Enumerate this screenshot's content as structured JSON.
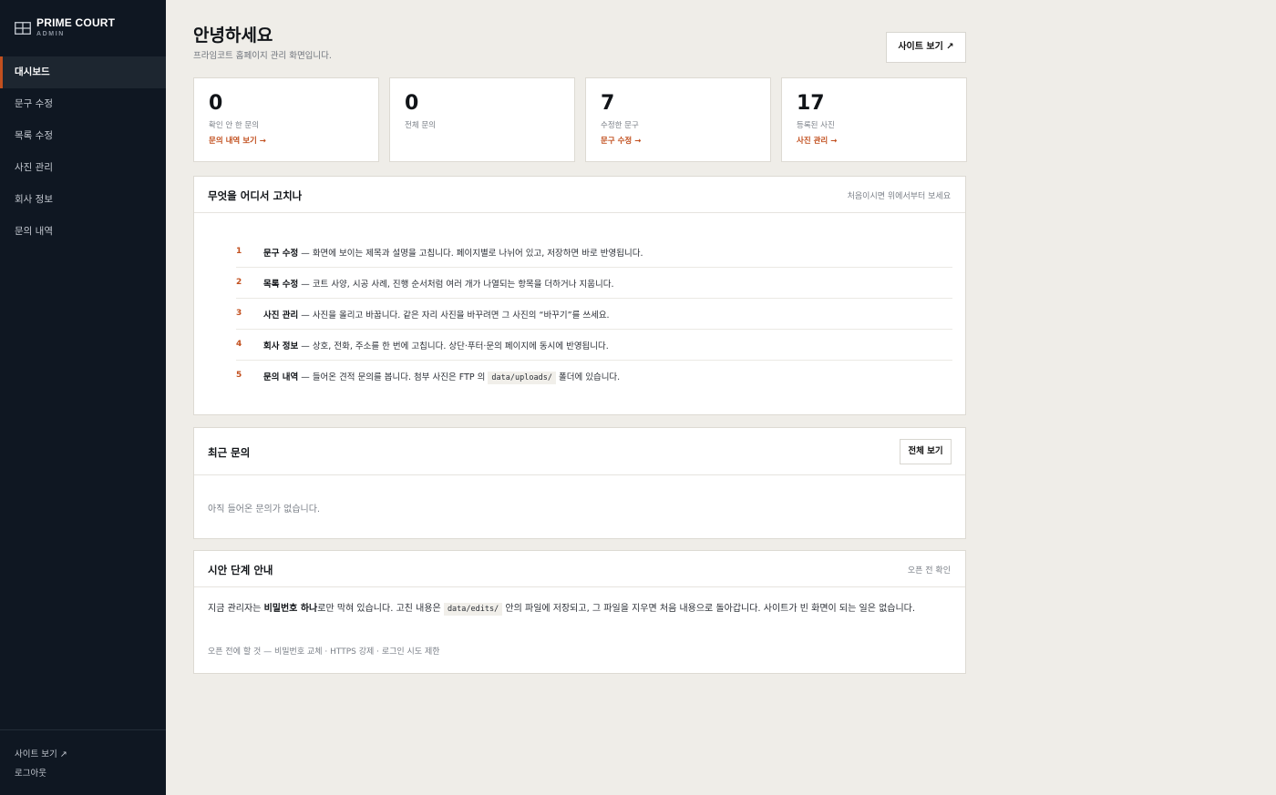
{
  "brand": {
    "name": "PRIME COURT",
    "sub": "ADMIN",
    "icon": "layout-grid-icon"
  },
  "nav": {
    "items": [
      {
        "label": "대시보드",
        "active": true
      },
      {
        "label": "문구 수정",
        "active": false
      },
      {
        "label": "목록 수정",
        "active": false
      },
      {
        "label": "사진 관리",
        "active": false
      },
      {
        "label": "회사 정보",
        "active": false
      },
      {
        "label": "문의 내역",
        "active": false
      }
    ]
  },
  "sidebar_footer": {
    "site_link": "사이트 보기 ↗",
    "logout": "로그아웃"
  },
  "header": {
    "title": "안녕하세요",
    "subtitle": "프라임코트 홈페이지 관리 화면입니다.",
    "site_button": "사이트 보기 ↗"
  },
  "stats": [
    {
      "value": "0",
      "label": "확인 안 한 문의",
      "link": "문의 내역 보기 →"
    },
    {
      "value": "0",
      "label": "전체 문의",
      "link": ""
    },
    {
      "value": "7",
      "label": "수정한 문구",
      "link": "문구 수정 →"
    },
    {
      "value": "17",
      "label": "등록된 사진",
      "link": "사진 관리 →"
    }
  ],
  "guide": {
    "title": "무엇을 어디서 고치나",
    "note": "처음이시면 위에서부터 보세요",
    "steps": [
      {
        "num": "1",
        "name": "문구 수정",
        "desc": " — 화면에 보이는 제목과 설명을 고칩니다. 페이지별로 나뉘어 있고, 저장하면 바로 반영됩니다."
      },
      {
        "num": "2",
        "name": "목록 수정",
        "desc": " — 코트 사양, 시공 사례, 진행 순서처럼 여러 개가 나열되는 항목을 더하거나 지웁니다."
      },
      {
        "num": "3",
        "name": "사진 관리",
        "desc": " — 사진을 올리고 바꿉니다. 같은 자리 사진을 바꾸려면 그 사진의 “바꾸기”를 쓰세요."
      },
      {
        "num": "4",
        "name": "회사 정보",
        "desc": " — 상호, 전화, 주소를 한 번에 고칩니다. 상단·푸터·문의 페이지에 동시에 반영됩니다."
      },
      {
        "num": "5",
        "name": "문의 내역",
        "desc": " — 들어온 견적 문의를 봅니다. 첨부 사진은 FTP 의 ",
        "code": "data/uploads/",
        "desc_after": " 폴더에 있습니다."
      }
    ]
  },
  "recent": {
    "title": "최근 문의",
    "button": "전체 보기",
    "empty": "아직 들어온 문의가 없습니다."
  },
  "staging": {
    "title": "시안 단계 안내",
    "note": "오픈 전 확인",
    "text_before": "지금 관리자는 ",
    "text_bold": "비밀번호 하나",
    "text_mid": "로만 막혀 있습니다. 고친 내용은 ",
    "code": "data/edits/",
    "text_after": " 안의 파일에 저장되고, 그 파일을 지우면 처음 내용으로 돌아갑니다. 사이트가 빈 화면이 되는 일은 없습니다.",
    "todo": "오픈 전에 할 것 — 비밀번호 교체 · HTTPS 강제 · 로그인 시도 제한"
  },
  "colors": {
    "accent": "#c2501f",
    "sidebar_bg": "#0f1722",
    "page_bg": "#efede8"
  }
}
